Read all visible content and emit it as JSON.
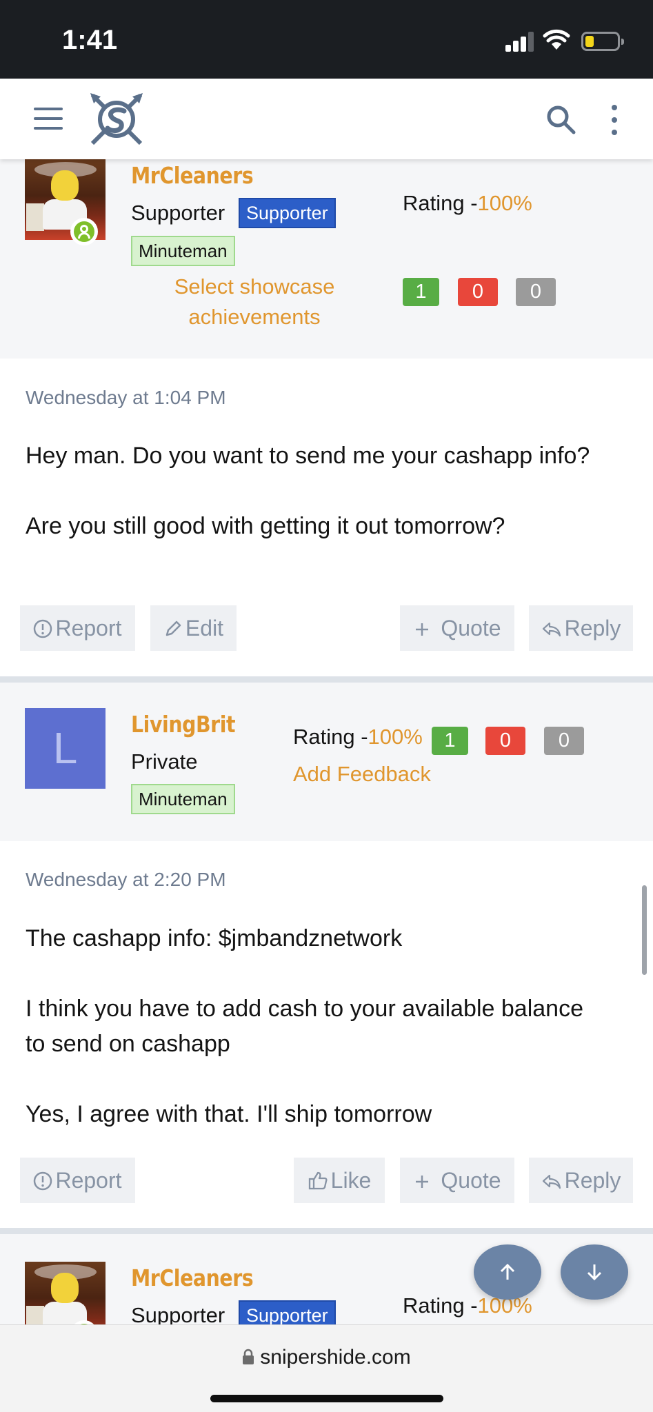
{
  "status_bar": {
    "time": "1:41"
  },
  "header": {
    "menu_icon": "hamburger-icon",
    "logo_icon": "snipershide-logo-icon",
    "search_icon": "search-icon",
    "more_icon": "more-vertical-icon"
  },
  "posts": [
    {
      "user": {
        "name": "MrCleaners",
        "title": "Supporter",
        "badge": "Supporter",
        "rank": "Minuteman",
        "rating_label": "Rating -",
        "rating_pct": "100%",
        "showcase_link": "Select showcase achievements",
        "feedback": {
          "positive": "1",
          "negative": "0",
          "neutral": "0"
        }
      },
      "date": "Wednesday at 1:04 PM",
      "paragraphs": [
        "Hey man. Do you want to send me your cashapp info?",
        "Are you still good with getting it out tomorrow?"
      ],
      "actions": {
        "report": "Report",
        "edit": "Edit",
        "quote": "Quote",
        "reply": "Reply"
      }
    },
    {
      "user": {
        "name": "LivingBrit",
        "avatar_letter": "L",
        "title": "Private",
        "rank": "Minuteman",
        "rating_label": "Rating -",
        "rating_pct": "100%",
        "add_feedback": "Add Feedback",
        "feedback": {
          "positive": "1",
          "negative": "0",
          "neutral": "0"
        }
      },
      "date": "Wednesday at 2:20 PM",
      "paragraphs": [
        "The cashapp info: $jmbandznetwork",
        "I think you have to add cash to your available balance to send on cashapp",
        "Yes, I agree with that. I'll ship tomorrow"
      ],
      "actions": {
        "report": "Report",
        "like": "Like",
        "quote": "Quote",
        "reply": "Reply"
      }
    },
    {
      "user": {
        "name": "MrCleaners",
        "title": "Supporter",
        "badge": "Supporter",
        "rating_label": "Rating -",
        "rating_pct": "100%"
      }
    }
  ],
  "floating": {
    "up_icon": "arrow-up-icon",
    "down_icon": "arrow-down-icon"
  },
  "browser": {
    "url": "snipershide.com",
    "lock_icon": "lock-icon"
  },
  "colors": {
    "accent_orange": "#e0962e",
    "supporter_blue": "#2c5ec8",
    "minuteman_green": "#d8f2cf",
    "feedback_positive": "#58ad45",
    "feedback_negative": "#e8473b",
    "feedback_neutral": "#9b9b9b",
    "user_panel_bg": "#f5f6f8"
  }
}
